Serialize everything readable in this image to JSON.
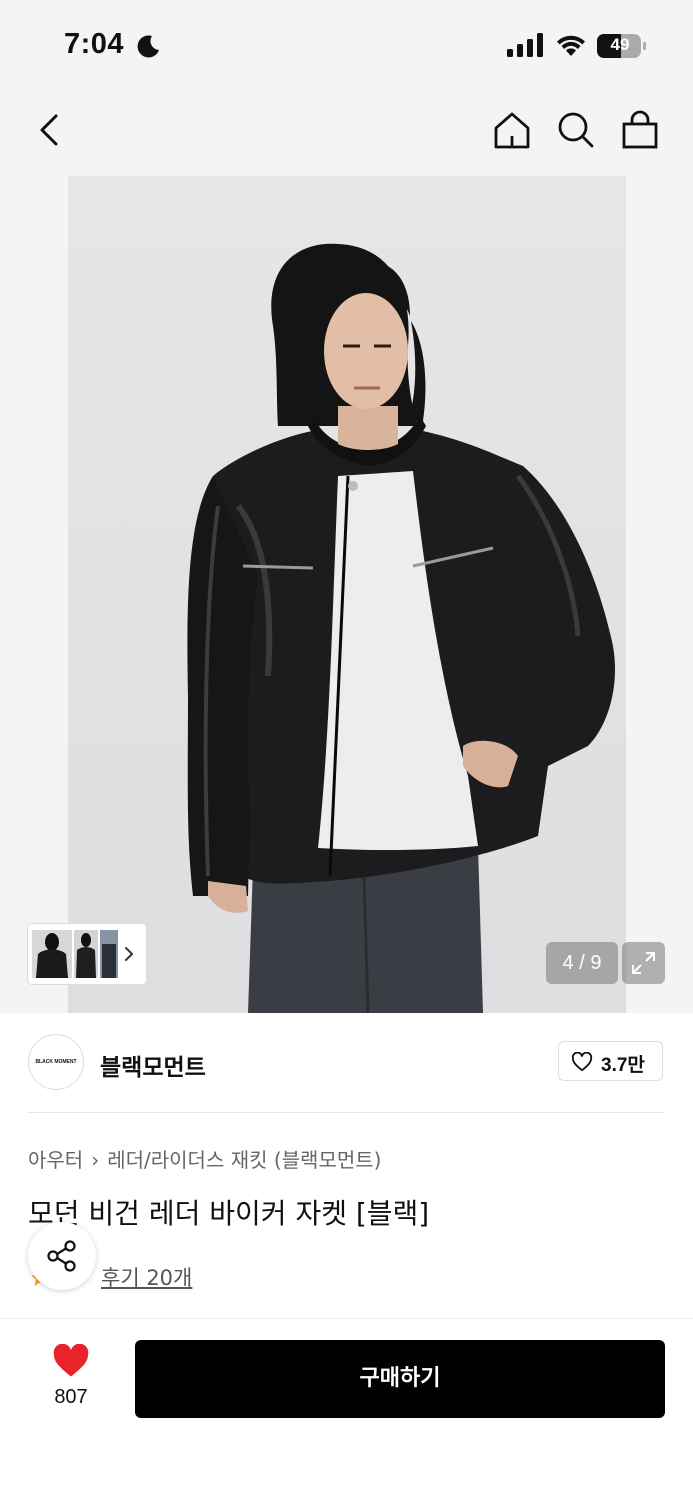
{
  "status_bar": {
    "time": "7:04",
    "battery": "49"
  },
  "nav": {
    "back_icon": "chevron-left-icon",
    "home_icon": "home-icon",
    "search_icon": "search-icon",
    "cart_icon": "shopping-bag-icon"
  },
  "gallery": {
    "counter": "4 / 9",
    "current_index": 4,
    "total": 9
  },
  "brand": {
    "logo_text": "BLACK MOMENT",
    "name": "블랙모먼트",
    "likes": "3.7만"
  },
  "product": {
    "breadcrumb": [
      "아우터",
      "레더/라이더스 재킷 (블랙모먼트)"
    ],
    "title": "모던 비건 레더 바이커 자켓 [블랙]",
    "review_link": "후기 20개"
  },
  "bottom_bar": {
    "wish_count": "807",
    "buy_label": "구매하기",
    "accent_color": "#e8232a"
  }
}
